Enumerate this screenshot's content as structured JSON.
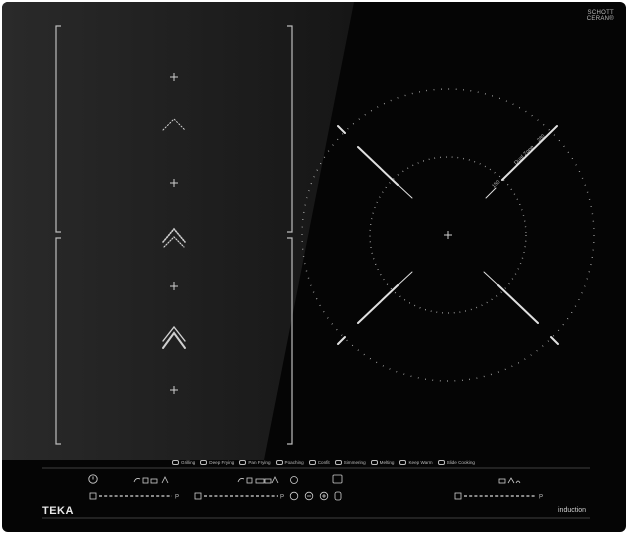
{
  "appliance": {
    "brand": "TEKA",
    "type_label": "induction",
    "glass_logo_line1": "SCHOTT",
    "glass_logo_line2": "CERAN®"
  },
  "zones": {
    "right_big": {
      "zone_name": "Dual Zone",
      "inner_size": "150",
      "outer_size": "280"
    }
  },
  "functions": [
    {
      "label": "Grilling",
      "icon": "grill-icon"
    },
    {
      "label": "Deep Frying",
      "icon": "deep-fry-icon"
    },
    {
      "label": "Pan Frying",
      "icon": "pan-fry-icon"
    },
    {
      "label": "Poaching",
      "icon": "poach-icon"
    },
    {
      "label": "Confit",
      "icon": "confit-icon"
    },
    {
      "label": "Simmering",
      "icon": "simmer-icon"
    },
    {
      "label": "Melting",
      "icon": "melt-icon"
    },
    {
      "label": "Keep Warm",
      "icon": "keep-warm-icon"
    },
    {
      "label": "Slide Cooking",
      "icon": "slide-cooking-icon"
    }
  ],
  "sliders": {
    "left_end_label": "P",
    "center_end_label": "P",
    "right_end_label": "P"
  }
}
